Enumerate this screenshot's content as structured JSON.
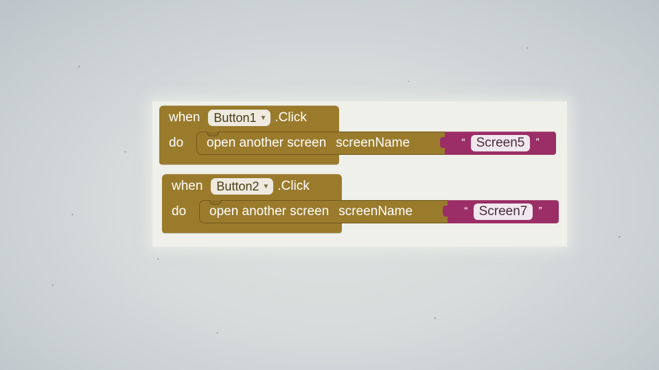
{
  "blocks": [
    {
      "keyword_when": "when",
      "component": "Button1",
      "event": ".Click",
      "keyword_do": "do",
      "action": "open another screen",
      "param_label": "screenName",
      "open_quote": "“",
      "value": "Screen5",
      "close_quote": "”"
    },
    {
      "keyword_when": "when",
      "component": "Button2",
      "event": ".Click",
      "keyword_do": "do",
      "action": "open another screen",
      "param_label": "screenName",
      "open_quote": "“",
      "value": "Screen7",
      "close_quote": "”"
    }
  ],
  "colors": {
    "event_block": "#9a7b2c",
    "text_block": "#9b2e66",
    "workspace": "#eef0e9"
  },
  "icons": {
    "dropdown": "chevron-down-icon"
  }
}
